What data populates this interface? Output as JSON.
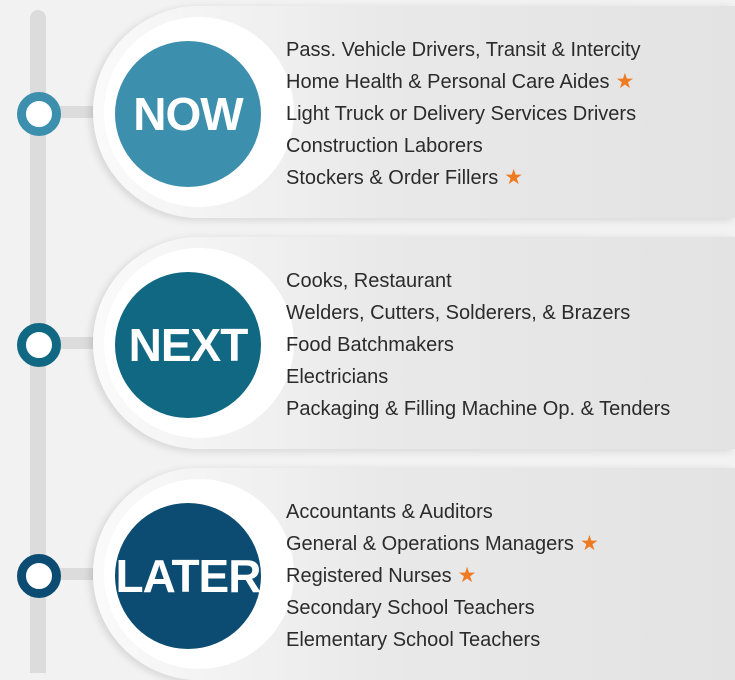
{
  "colors": {
    "now": "#3d8fae",
    "next": "#106882",
    "later": "#0c4c72",
    "star": "#ee7a22"
  },
  "stages": [
    {
      "label": "NOW",
      "items": [
        {
          "text": "Pass. Vehicle Drivers, Transit & Intercity",
          "star": ""
        },
        {
          "text": "Home Health & Personal Care Aides",
          "star": "★"
        },
        {
          "text": "Light Truck or Delivery Services Drivers",
          "star": ""
        },
        {
          "text": "Construction Laborers",
          "star": ""
        },
        {
          "text": "Stockers & Order Fillers",
          "star": "★"
        }
      ]
    },
    {
      "label": "NEXT",
      "items": [
        {
          "text": "Cooks, Restaurant",
          "star": ""
        },
        {
          "text": "Welders, Cutters, Solderers, & Brazers",
          "star": ""
        },
        {
          "text": "Food Batchmakers",
          "star": ""
        },
        {
          "text": "Electricians",
          "star": ""
        },
        {
          "text": "Packaging & Filling Machine Op. & Tenders",
          "star": ""
        }
      ]
    },
    {
      "label": "LATER",
      "items": [
        {
          "text": "Accountants & Auditors",
          "star": ""
        },
        {
          "text": "General & Operations Managers",
          "star": "★"
        },
        {
          "text": "Registered Nurses",
          "star": "★"
        },
        {
          "text": "Secondary School Teachers",
          "star": ""
        },
        {
          "text": "Elementary School Teachers",
          "star": ""
        }
      ]
    }
  ]
}
